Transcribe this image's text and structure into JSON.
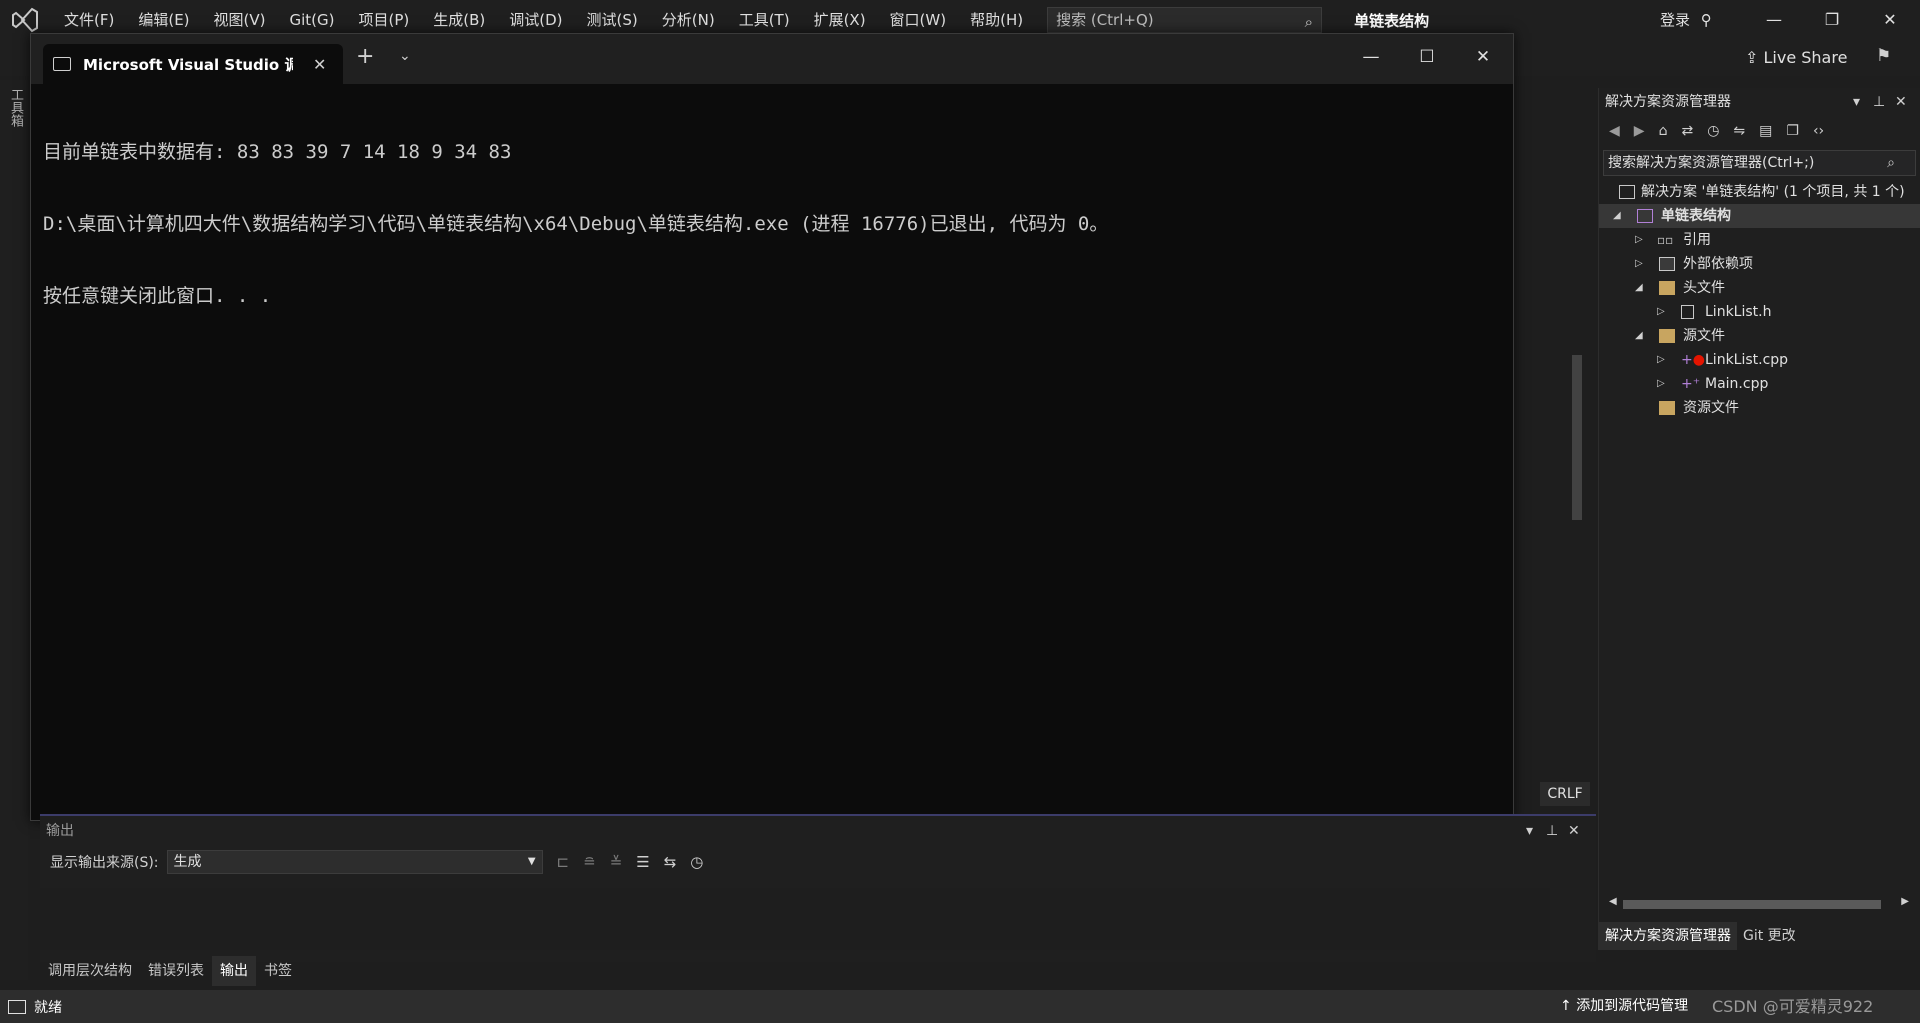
{
  "menubar": {
    "items": [
      "文件(F)",
      "编辑(E)",
      "视图(V)",
      "Git(G)",
      "项目(P)",
      "生成(B)",
      "调试(D)",
      "测试(S)",
      "分析(N)",
      "工具(T)",
      "扩展(X)",
      "窗口(W)",
      "帮助(H)"
    ],
    "search_placeholder": "搜索 (Ctrl+Q)",
    "solution_title": "单链表结构",
    "login": "登录"
  },
  "toolbar": {
    "live_share": "Live Share"
  },
  "toolbox": {
    "label": "工具箱"
  },
  "console": {
    "tab_title": "Microsoft Visual Studio 调试控制台",
    "lines": [
      "目前单链表中数据有: 83 83 39 7 14 18 9 34 83",
      "D:\\桌面\\计算机四大件\\数据结构学习\\代码\\单链表结构\\x64\\Debug\\单链表结构.exe (进程 16776)已退出, 代码为 0。",
      "按任意键关闭此窗口. . ."
    ]
  },
  "editor": {
    "line_ending": "CRLF"
  },
  "solution_explorer": {
    "title": "解决方案资源管理器",
    "search_placeholder": "搜索解决方案资源管理器(Ctrl+;)",
    "tree": {
      "solution": "解决方案 '单链表结构' (1 个项目, 共 1 个)",
      "project": "单链表结构",
      "references": "引用",
      "external_deps": "外部依赖项",
      "header_files": "头文件",
      "header_file_1": "LinkList.h",
      "source_files": "源文件",
      "source_file_1": "LinkList.cpp",
      "source_file_2": "Main.cpp",
      "resource_files": "资源文件"
    },
    "tabs": [
      "解决方案资源管理器",
      "Git 更改"
    ]
  },
  "output": {
    "title": "输出",
    "source_label": "显示输出来源(S):",
    "source_value": "生成"
  },
  "bottom_tabs": [
    "调用层次结构",
    "错误列表",
    "输出",
    "书签"
  ],
  "statusbar": {
    "ready": "就绪",
    "add_source": "添加到源代码管理",
    "watermark": "CSDN @可爱精灵922"
  }
}
